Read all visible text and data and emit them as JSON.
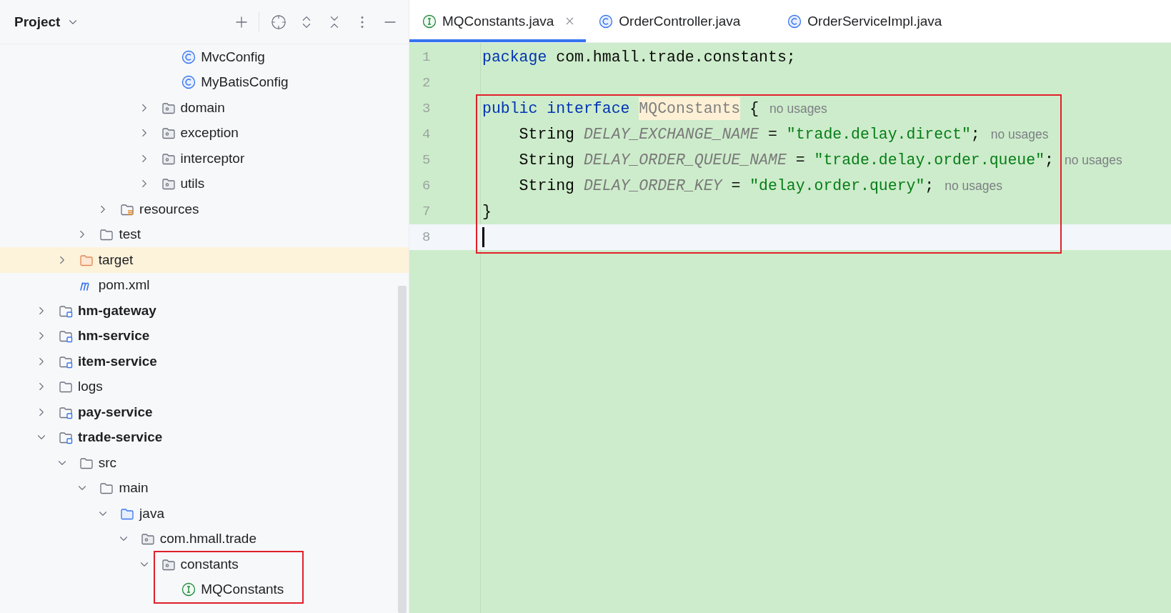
{
  "project_panel": {
    "title": "Project",
    "tree": [
      {
        "children": [
          {
            "children": [
              {
                "children": [
                  {
                    "children": [
                      {
                        "children": [
                          {
                            "children": [
                              {
                                "label": "MvcConfig",
                                "kind": "class",
                                "selected": false
                              },
                              {
                                "label": "MyBatisConfig",
                                "kind": "class",
                                "selected": false
                              }
                            ]
                          },
                          {
                            "label": "domain",
                            "kind": "package",
                            "expanded": false,
                            "selected": false
                          },
                          {
                            "label": "exception",
                            "kind": "package",
                            "expanded": false,
                            "selected": false
                          },
                          {
                            "label": "interceptor",
                            "kind": "package",
                            "expanded": false,
                            "selected": false
                          },
                          {
                            "label": "utils",
                            "kind": "package",
                            "expanded": false,
                            "selected": false
                          }
                        ]
                      }
                    ]
                  },
                  {
                    "label": "resources",
                    "kind": "resources",
                    "expanded": false,
                    "selected": false
                  }
                ]
              },
              {
                "label": "test",
                "kind": "folder",
                "expanded": false,
                "selected": false
              }
            ]
          },
          {
            "label": "target",
            "kind": "excluded",
            "expanded": false,
            "selected": true
          },
          {
            "label": "pom.xml",
            "kind": "maven",
            "selected": false
          }
        ]
      },
      {
        "label": "hm-gateway",
        "kind": "module",
        "expanded": false,
        "selected": false
      },
      {
        "label": "hm-service",
        "kind": "module",
        "expanded": false,
        "selected": false
      },
      {
        "label": "item-service",
        "kind": "module",
        "expanded": false,
        "selected": false
      },
      {
        "label": "logs",
        "kind": "folder",
        "expanded": false,
        "selected": false
      },
      {
        "label": "pay-service",
        "kind": "module",
        "expanded": false,
        "selected": false
      },
      {
        "label": "trade-service",
        "kind": "module",
        "expanded": true,
        "selected": false,
        "children": [
          {
            "label": "src",
            "kind": "folder",
            "expanded": true,
            "selected": false,
            "children": [
              {
                "label": "main",
                "kind": "folder",
                "expanded": true,
                "selected": false,
                "children": [
                  {
                    "label": "java",
                    "kind": "source-root",
                    "expanded": true,
                    "selected": false,
                    "children": [
                      {
                        "label": "com.hmall.trade",
                        "kind": "package",
                        "expanded": true,
                        "selected": false,
                        "children": [
                          {
                            "label": "constants",
                            "kind": "package",
                            "expanded": true,
                            "selected": false,
                            "annotated": true,
                            "children": [
                              {
                                "label": "MQConstants",
                                "kind": "interface",
                                "selected": false,
                                "annotated": true
                              }
                            ]
                          }
                        ]
                      }
                    ]
                  }
                ]
              }
            ]
          }
        ]
      }
    ]
  },
  "tabs": [
    {
      "label": "MQConstants.java",
      "kind": "interface",
      "selected": true
    },
    {
      "label": "OrderController.java",
      "kind": "class",
      "selected": false
    },
    {
      "label": "OrderServiceImpl.java",
      "kind": "class",
      "selected": false
    }
  ],
  "code": {
    "lines": [
      {
        "number": "1",
        "current": false,
        "annotated": false,
        "tokens": [
          {
            "text": "package",
            "kind": "keyword"
          },
          {
            "text": " com.hmall.trade.constants;",
            "kind": "plain"
          }
        ]
      },
      {
        "number": "2",
        "current": false,
        "annotated": false
      },
      {
        "number": "3",
        "current": false,
        "annotated": true,
        "tokens": [
          {
            "text": "public interface ",
            "kind": "keyword"
          },
          {
            "text": "MQConstants",
            "kind": "unused-class"
          },
          {
            "text": " {",
            "kind": "plain"
          },
          {
            "text": "no usages",
            "kind": "hint"
          }
        ]
      },
      {
        "number": "4",
        "current": false,
        "annotated": true,
        "tokens": [
          {
            "text": "    String ",
            "kind": "plain"
          },
          {
            "text": "DELAY_EXCHANGE_NAME",
            "kind": "constant"
          },
          {
            "text": " = ",
            "kind": "plain"
          },
          {
            "text": "\"trade.delay.direct\"",
            "kind": "string"
          },
          {
            "text": ";",
            "kind": "plain"
          },
          {
            "text": "no usages",
            "kind": "hint"
          }
        ]
      },
      {
        "number": "5",
        "current": false,
        "annotated": true,
        "tokens": [
          {
            "text": "    String ",
            "kind": "plain"
          },
          {
            "text": "DELAY_ORDER_QUEUE_NAME",
            "kind": "constant"
          },
          {
            "text": " = ",
            "kind": "plain"
          },
          {
            "text": "\"trade.delay.order.queue\"",
            "kind": "string"
          },
          {
            "text": ";",
            "kind": "plain"
          },
          {
            "text": "no usages",
            "kind": "hint"
          }
        ]
      },
      {
        "number": "6",
        "current": false,
        "annotated": true,
        "tokens": [
          {
            "text": "    String ",
            "kind": "plain"
          },
          {
            "text": "DELAY_ORDER_KEY",
            "kind": "constant"
          },
          {
            "text": " = ",
            "kind": "plain"
          },
          {
            "text": "\"delay.order.query\"",
            "kind": "string"
          },
          {
            "text": ";",
            "kind": "plain"
          },
          {
            "text": "no usages",
            "kind": "hint"
          }
        ]
      },
      {
        "number": "7",
        "current": false,
        "annotated": true,
        "tokens": [
          {
            "text": "}",
            "kind": "plain"
          }
        ]
      },
      {
        "number": "8",
        "current": true,
        "annotated": true
      }
    ]
  }
}
